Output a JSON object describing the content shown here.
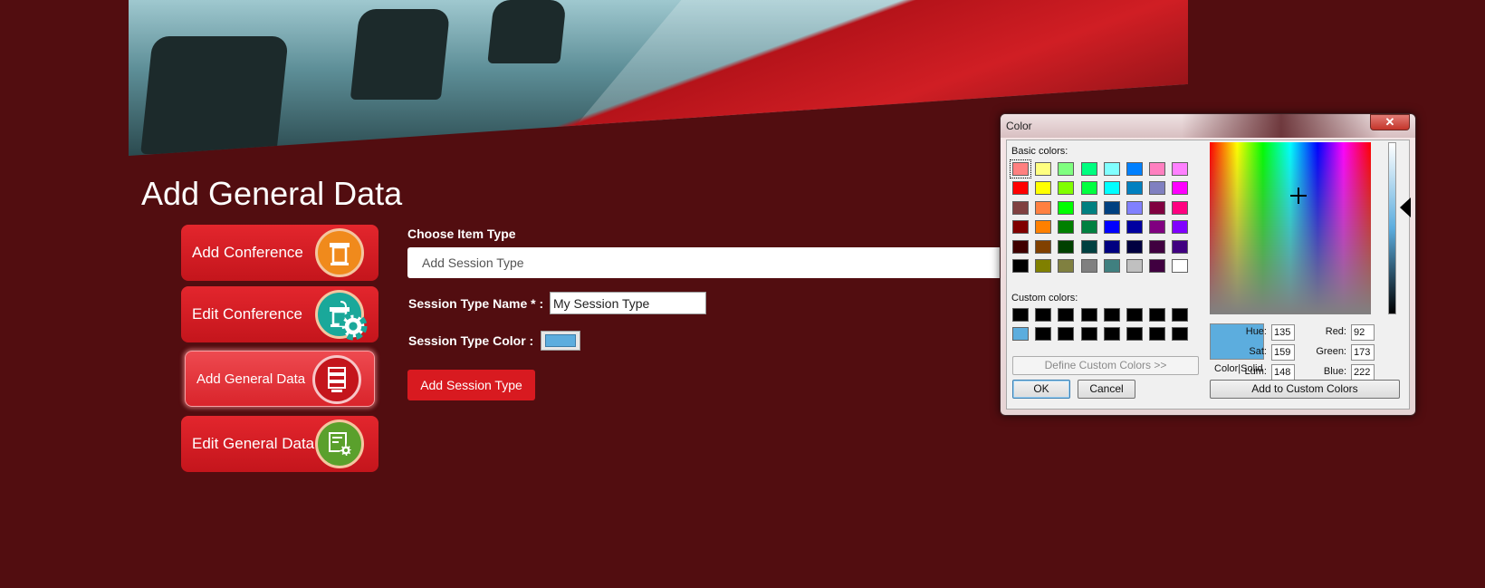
{
  "page": {
    "title": "Add General Data"
  },
  "menu": {
    "items": [
      {
        "label": "Add Conference",
        "icon": "podium-icon",
        "icon_color": "#f08a1c"
      },
      {
        "label": "Edit Conference",
        "icon": "podium-settings-icon",
        "icon_color": "#1aa89a"
      },
      {
        "label": "Add General Data",
        "icon": "server-stack-icon",
        "icon_color": "#c4151c",
        "active": true
      },
      {
        "label": "Edit General Data",
        "icon": "document-settings-icon",
        "icon_color": "#5aa02c"
      }
    ]
  },
  "form": {
    "item_type_label": "Choose Item Type",
    "item_type_value": "Add Session Type",
    "name_label": "Session Type Name * :",
    "name_value": "My Session Type",
    "color_label": "Session Type Color :",
    "color_value": "#5cadde",
    "submit_label": "Add Session Type"
  },
  "color_dialog": {
    "title": "Color",
    "close_label": "✕",
    "basic_colors_label": "Basic colors:",
    "basic_colors": [
      [
        "#ff8080",
        "#ffff80",
        "#80ff80",
        "#00ff80",
        "#80ffff",
        "#0080ff",
        "#ff80c0",
        "#ff80ff"
      ],
      [
        "#ff0000",
        "#ffff00",
        "#80ff00",
        "#00ff40",
        "#00ffff",
        "#0080c0",
        "#8080c0",
        "#ff00ff"
      ],
      [
        "#804040",
        "#ff8040",
        "#00ff00",
        "#008080",
        "#004080",
        "#8080ff",
        "#800040",
        "#ff0080"
      ],
      [
        "#800000",
        "#ff8000",
        "#008000",
        "#008040",
        "#0000ff",
        "#0000a0",
        "#800080",
        "#8000ff"
      ],
      [
        "#400000",
        "#804000",
        "#004000",
        "#004040",
        "#000080",
        "#000040",
        "#400040",
        "#400080"
      ],
      [
        "#000000",
        "#808000",
        "#808040",
        "#808080",
        "#408080",
        "#c0c0c0",
        "#400040",
        "#ffffff"
      ]
    ],
    "custom_colors_label": "Custom colors:",
    "custom_colors": [
      [
        "#000000",
        "#000000",
        "#000000",
        "#000000",
        "#000000",
        "#000000",
        "#000000",
        "#000000"
      ],
      [
        "#5cadde",
        "#000000",
        "#000000",
        "#000000",
        "#000000",
        "#000000",
        "#000000",
        "#000000"
      ]
    ],
    "define_custom_label": "Define Custom Colors >>",
    "ok_label": "OK",
    "cancel_label": "Cancel",
    "preview_label": "Color|Solid",
    "add_custom_label": "Add to Custom Colors",
    "hue_label": "Hue:",
    "sat_label": "Sat:",
    "lum_label": "Lum:",
    "red_label": "Red:",
    "green_label": "Green:",
    "blue_label": "Blue:",
    "hue": "135",
    "sat": "159",
    "lum": "148",
    "red": "92",
    "green": "173",
    "blue": "222",
    "selected_color": "#5cadde"
  }
}
